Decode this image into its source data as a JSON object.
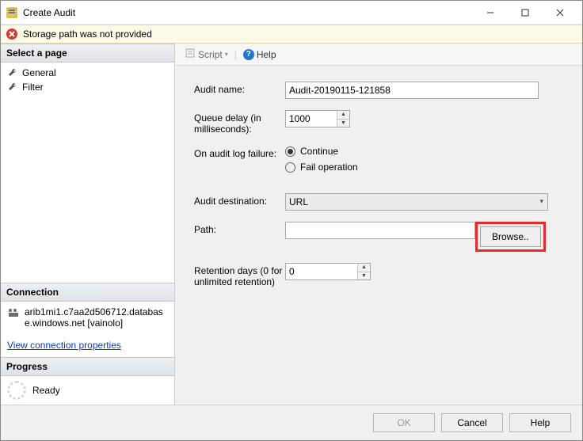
{
  "window": {
    "title": "Create Audit"
  },
  "errorbar": {
    "message": "Storage path was not provided"
  },
  "sidebar": {
    "select_page_header": "Select a page",
    "pages": [
      {
        "label": "General"
      },
      {
        "label": "Filter"
      }
    ],
    "connection_header": "Connection",
    "connection_text": "arib1mi1.c7aa2d506712.database.windows.net [vainolo]",
    "connection_link": "View connection properties",
    "progress_header": "Progress",
    "progress_status": "Ready"
  },
  "toolbar": {
    "script_label": "Script",
    "help_label": "Help"
  },
  "form": {
    "audit_name_label": "Audit name:",
    "audit_name_value": "Audit-20190115-121858",
    "queue_delay_label": "Queue delay (in milliseconds):",
    "queue_delay_value": "1000",
    "on_failure_label": "On audit log failure:",
    "on_failure_options": {
      "continue": "Continue",
      "fail": "Fail operation"
    },
    "on_failure_selected": "continue",
    "destination_label": "Audit destination:",
    "destination_value": "URL",
    "path_label": "Path:",
    "path_value": "",
    "browse_label": "Browse..",
    "retention_label": "Retention days (0 for unlimited retention)",
    "retention_value": "0"
  },
  "footer": {
    "ok_label": "OK",
    "cancel_label": "Cancel",
    "help_label": "Help"
  }
}
